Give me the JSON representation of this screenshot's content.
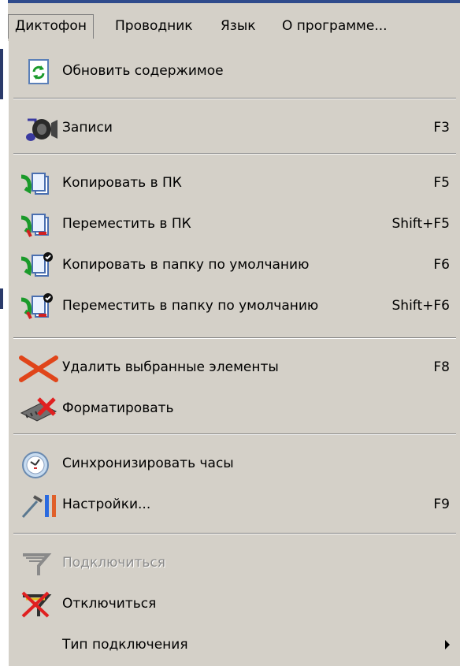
{
  "menubar": {
    "items": [
      {
        "label": "Диктофон"
      },
      {
        "label": "Проводник"
      },
      {
        "label": "Язык"
      },
      {
        "label": "О программе..."
      }
    ]
  },
  "dropdown": {
    "items": [
      {
        "label": "Обновить содержимое",
        "shortcut": "",
        "icon": "refresh-icon"
      },
      {
        "label": "Записи",
        "shortcut": "F3",
        "icon": "audio-notes-icon"
      },
      {
        "label": "Копировать в ПК",
        "shortcut": "F5",
        "icon": "copy-to-pc-icon"
      },
      {
        "label": "Переместить в ПК",
        "shortcut": "Shift+F5",
        "icon": "move-to-pc-icon"
      },
      {
        "label": "Копировать в папку по умолчанию",
        "shortcut": "F6",
        "icon": "copy-to-default-folder-icon"
      },
      {
        "label": "Переместить в папку по умолчанию",
        "shortcut": "Shift+F6",
        "icon": "move-to-default-folder-icon"
      },
      {
        "label": "Удалить выбранные элементы",
        "shortcut": "F8",
        "icon": "delete-x-icon"
      },
      {
        "label": "Форматировать",
        "shortcut": "",
        "icon": "format-chip-icon"
      },
      {
        "label": "Синхронизировать часы",
        "shortcut": "",
        "icon": "clock-icon"
      },
      {
        "label": "Настройки...",
        "shortcut": "F9",
        "icon": "settings-tools-icon"
      },
      {
        "label": "Подключиться",
        "shortcut": "",
        "icon": "connect-plug-icon",
        "disabled": true
      },
      {
        "label": "Отключиться",
        "shortcut": "",
        "icon": "disconnect-plug-icon"
      },
      {
        "label": "Тип подключения",
        "shortcut": "",
        "icon": "",
        "submenu": true
      }
    ]
  },
  "colors": {
    "menu_bg": "#d4d0c8",
    "title_bar": "#2f4b8c",
    "disabled_text": "#8a8a8a"
  }
}
